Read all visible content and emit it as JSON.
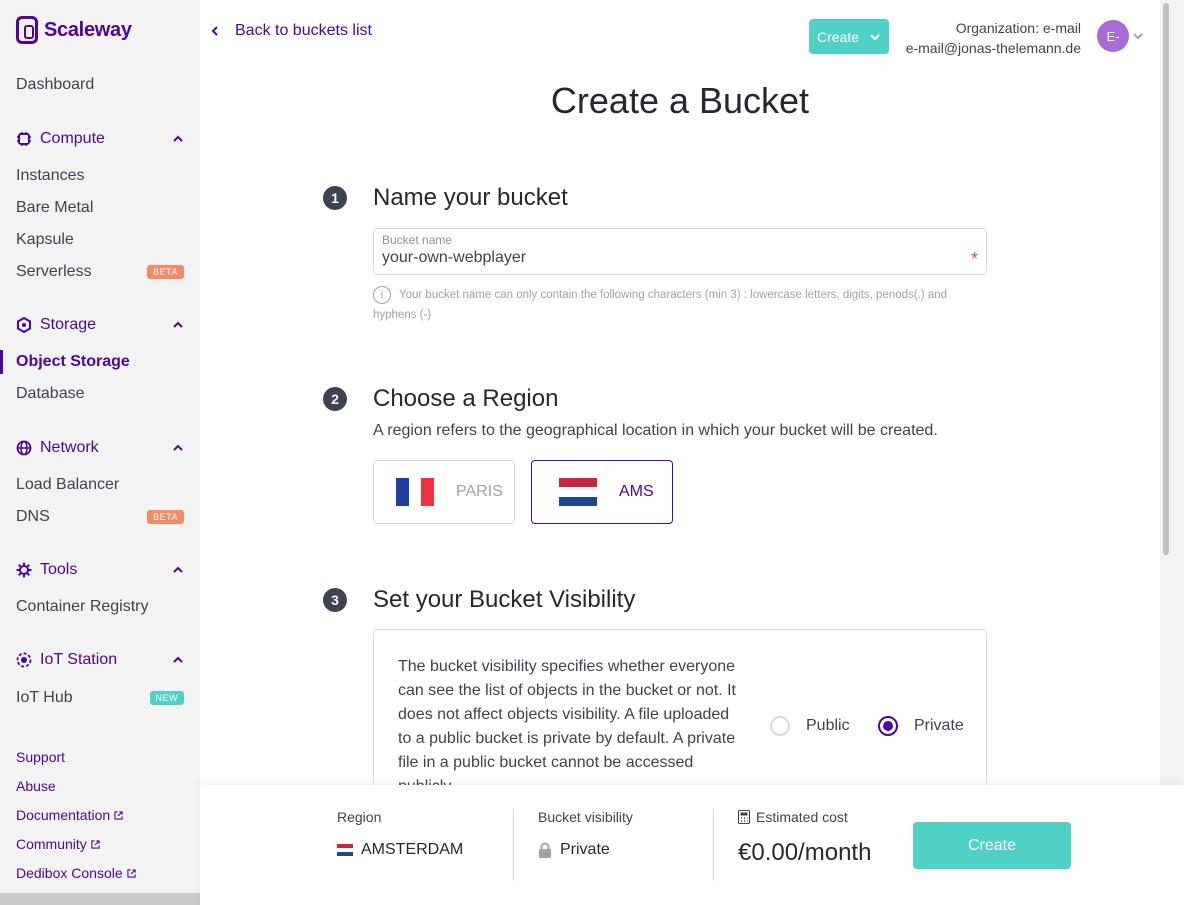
{
  "app": {
    "logo_text": "Scaleway"
  },
  "sidebar": {
    "dashboard": "Dashboard",
    "sections": [
      {
        "label": "Compute",
        "items": [
          {
            "label": "Instances"
          },
          {
            "label": "Bare Metal"
          },
          {
            "label": "Kapsule"
          },
          {
            "label": "Serverless",
            "badge": "BETA"
          }
        ]
      },
      {
        "label": "Storage",
        "items": [
          {
            "label": "Object Storage"
          },
          {
            "label": "Database"
          }
        ]
      },
      {
        "label": "Network",
        "items": [
          {
            "label": "Load Balancer"
          },
          {
            "label": "DNS",
            "badge": "BETA"
          }
        ]
      },
      {
        "label": "Tools",
        "items": [
          {
            "label": "Container Registry"
          }
        ]
      },
      {
        "label": "IoT Station",
        "items": [
          {
            "label": "IoT Hub",
            "badge": "NEW"
          }
        ]
      }
    ],
    "footer_links": [
      "Support",
      "Abuse",
      "Documentation",
      "Community",
      "Dedibox Console"
    ]
  },
  "header": {
    "back_label": "Back to buckets list",
    "create_label": "Create",
    "org_name": "Organization: e-mail",
    "org_email": "e-mail@jonas-thelemann.de",
    "avatar_initials": "E-"
  },
  "main": {
    "title": "Create a Bucket",
    "step1": {
      "num": "1",
      "title": "Name your bucket",
      "input_label": "Bucket name",
      "input_value": "your-own-webplayer",
      "required_mark": "*",
      "hint": "Your bucket name can only contain the following characters (min 3) : lowercase letters, digits, periods(.) and hyphens (-)"
    },
    "step2": {
      "num": "2",
      "title": "Choose a Region",
      "description": "A region refers to the geographical location in which your bucket will be created.",
      "regions": [
        {
          "label": "PARIS",
          "selected": false
        },
        {
          "label": "AMS",
          "selected": true
        }
      ]
    },
    "step3": {
      "num": "3",
      "title": "Set your Bucket Visibility",
      "description": "The bucket visibility specifies whether everyone can see the list of objects in the bucket or not. It does not affect objects visibility. A file uploaded to a public bucket is private by default. A private file in a public bucket cannot be accessed publicly.",
      "options": [
        {
          "label": "Public",
          "selected": false
        },
        {
          "label": "Private",
          "selected": true
        }
      ]
    }
  },
  "summary": {
    "region_label": "Region",
    "region_value": "AMSTERDAM",
    "visibility_label": "Bucket visibility",
    "visibility_value": "Private",
    "cost_label": "Estimated cost",
    "cost_value": "€0.00/month",
    "create_label": "Create"
  },
  "colors": {
    "brand": "#4f0599",
    "accent": "#4fd1c5",
    "beta": "#f28b66",
    "required": "#e84a75"
  }
}
